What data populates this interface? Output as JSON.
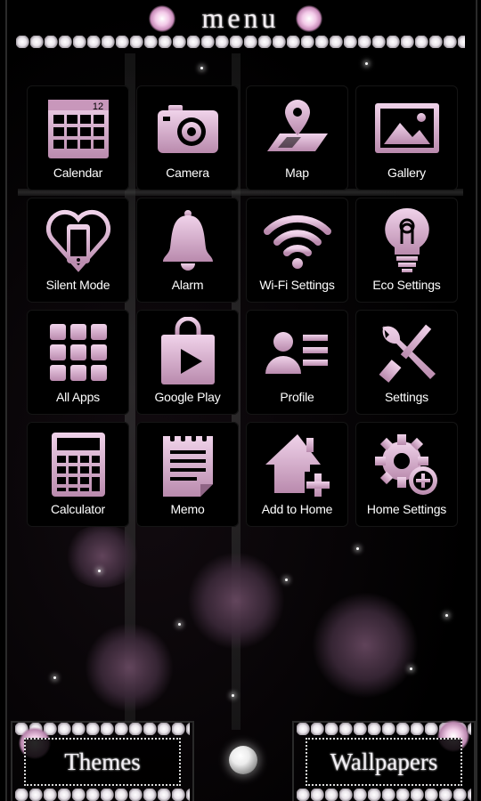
{
  "header": {
    "title": "menu"
  },
  "apps": [
    {
      "label": "Calendar",
      "icon": "calendar-icon",
      "badge": "12"
    },
    {
      "label": "Camera",
      "icon": "camera-icon"
    },
    {
      "label": "Map",
      "icon": "map-icon"
    },
    {
      "label": "Gallery",
      "icon": "gallery-icon"
    },
    {
      "label": "Silent Mode",
      "icon": "silent-mode-icon"
    },
    {
      "label": "Alarm",
      "icon": "bell-icon"
    },
    {
      "label": "Wi-Fi Settings",
      "icon": "wifi-icon"
    },
    {
      "label": "Eco Settings",
      "icon": "lightbulb-icon"
    },
    {
      "label": "All Apps",
      "icon": "grid-icon"
    },
    {
      "label": "Google Play",
      "icon": "play-store-icon"
    },
    {
      "label": "Profile",
      "icon": "profile-icon"
    },
    {
      "label": "Settings",
      "icon": "tools-icon"
    },
    {
      "label": "Calculator",
      "icon": "calculator-icon"
    },
    {
      "label": "Memo",
      "icon": "notepad-icon"
    },
    {
      "label": "Add to Home",
      "icon": "add-home-icon"
    },
    {
      "label": "Home Settings",
      "icon": "gear-plus-icon"
    }
  ],
  "buttons": {
    "themes": "Themes",
    "wallpapers": "Wallpapers"
  },
  "colors": {
    "icon_pink": "#dcb6d3",
    "icon_pink_dark": "#a77a9b",
    "background": "#000000"
  }
}
